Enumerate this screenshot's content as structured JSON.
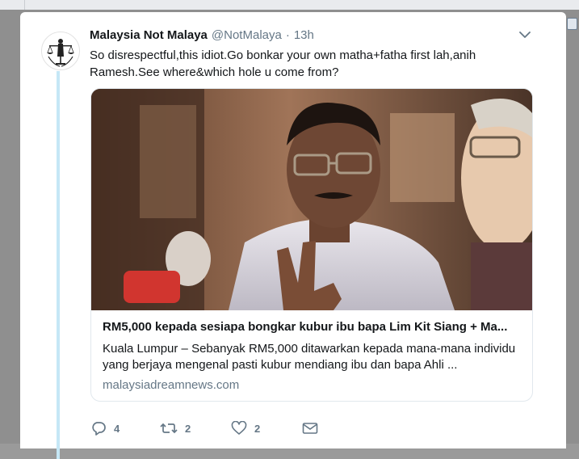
{
  "tweet": {
    "author_name": "Malaysia Not Malaya",
    "author_handle": "@NotMalaya",
    "separator": "·",
    "time": "13h",
    "text": "So disrespectful,this idiot.Go bonkar your own matha+fatha first lah,anih Ramesh.See where&which hole u come from?"
  },
  "link_card": {
    "title": "RM5,000 kepada sesiapa bongkar kubur ibu bapa Lim Kit Siang + Ma...",
    "description": "Kuala Lumpur – Sebanyak RM5,000 ditawarkan kepada mana-mana individu yang berjaya mengenal pasti kubur mendiang ibu dan bapa Ahli ...",
    "domain": "malaysiadreamnews.com"
  },
  "actions": {
    "reply_count": "4",
    "retweet_count": "2",
    "like_count": "2"
  },
  "icons": {
    "reply": "reply-icon",
    "retweet": "retweet-icon",
    "like": "heart-icon",
    "message": "envelope-icon",
    "menu": "chevron-down-icon"
  },
  "colors": {
    "text": "#14171a",
    "secondary": "#657786",
    "thread_line": "#c5e7f6",
    "border": "#e1e8ed"
  }
}
